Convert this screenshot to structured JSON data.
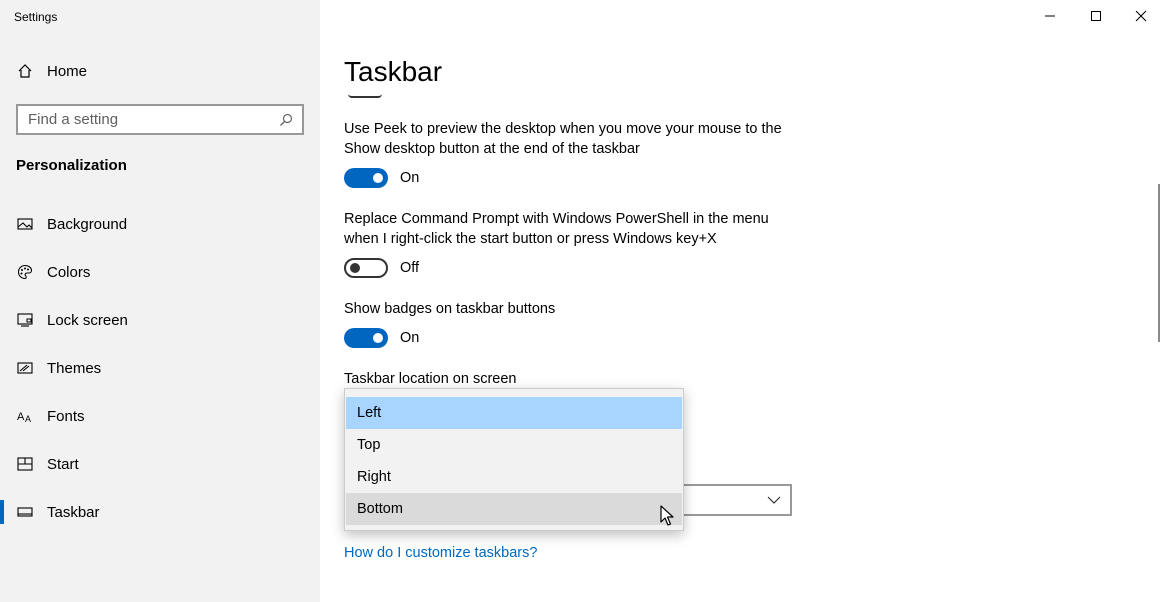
{
  "window": {
    "title": "Settings"
  },
  "sidebar": {
    "home_label": "Home",
    "search_placeholder": "Find a setting",
    "section_title": "Personalization",
    "items": [
      {
        "label": "Background",
        "icon": "picture-icon"
      },
      {
        "label": "Colors",
        "icon": "palette-icon"
      },
      {
        "label": "Lock screen",
        "icon": "lock-screen-icon"
      },
      {
        "label": "Themes",
        "icon": "themes-icon"
      },
      {
        "label": "Fonts",
        "icon": "fonts-icon"
      },
      {
        "label": "Start",
        "icon": "start-icon"
      },
      {
        "label": "Taskbar",
        "icon": "taskbar-icon",
        "selected": true
      }
    ]
  },
  "main": {
    "title": "Taskbar",
    "settings": [
      {
        "text": "Use Peek to preview the desktop when you move your mouse to the Show desktop button at the end of the taskbar",
        "state": "On"
      },
      {
        "text": "Replace Command Prompt with Windows PowerShell in the menu when I right-click the start button or press Windows key+X",
        "state": "Off"
      },
      {
        "text": "Show badges on taskbar buttons",
        "state": "On"
      }
    ],
    "location_label": "Taskbar location on screen",
    "dropdown_options": [
      "Left",
      "Top",
      "Right",
      "Bottom"
    ],
    "selected_option": "Left",
    "hovered_option": "Bottom",
    "help_link": "How do I customize taskbars?"
  },
  "colors": {
    "accent": "#0067c0",
    "sidebar_bg": "#f2f2f2",
    "selected_option_bg": "#a8d5ff",
    "hover_option_bg": "#dadada"
  }
}
